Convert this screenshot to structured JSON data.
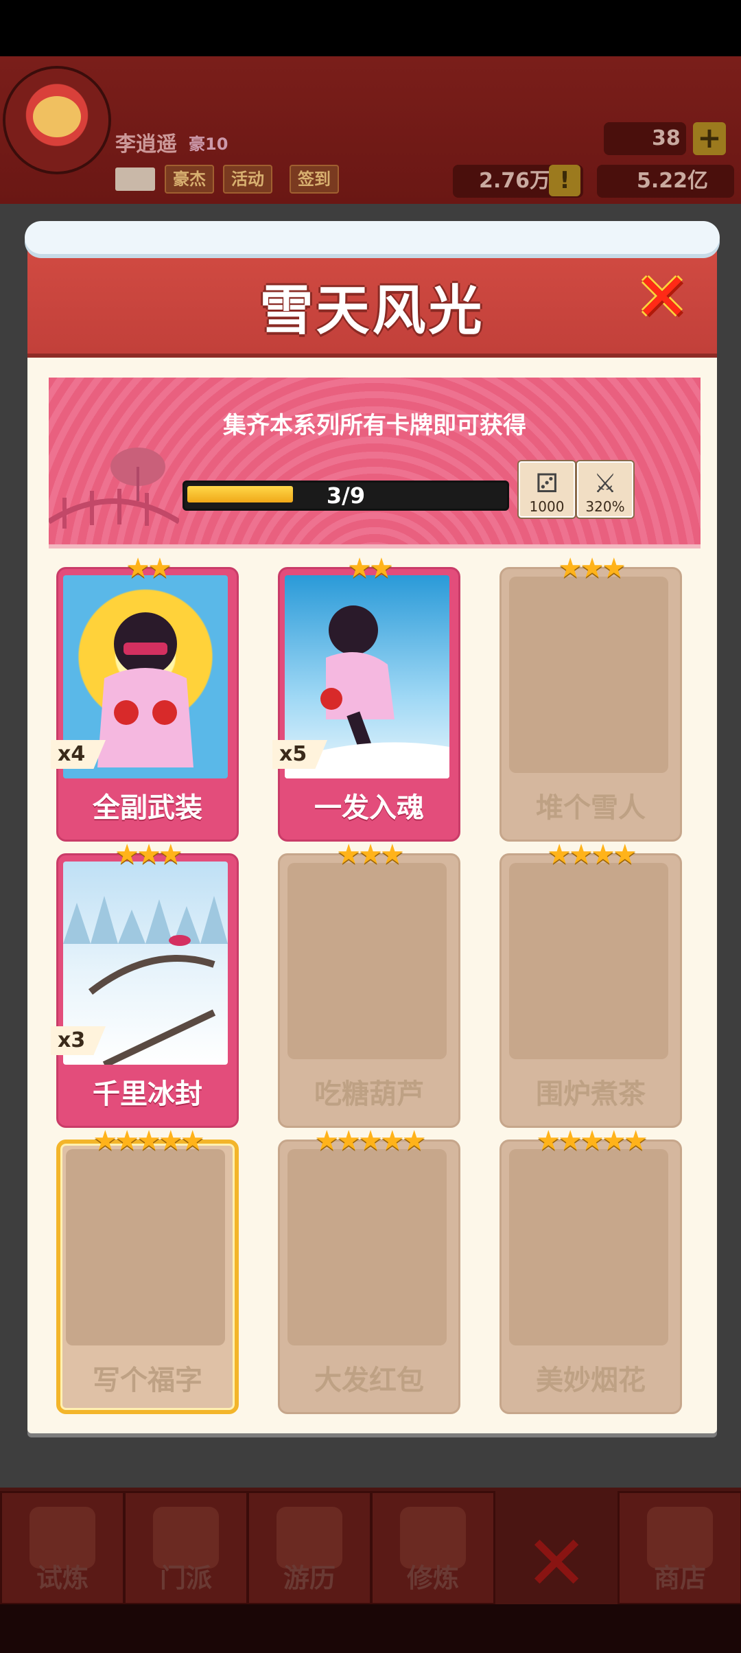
{
  "header": {
    "player_name": "李逍遥",
    "player_level": "豪10",
    "buttons": [
      "豪杰",
      "活动",
      "签到"
    ],
    "gems": "38",
    "power": "2.76万",
    "coins": "5.22亿",
    "plus": "+",
    "warn": "!"
  },
  "modal": {
    "title": "雪天风光",
    "close_glyph": "✕",
    "banner_text": "集齐本系列所有卡牌即可获得",
    "progress_text": "3/9",
    "progress_fraction": 0.333,
    "rewards": [
      {
        "icon": "dice-icon",
        "glyph": "⚂",
        "label": "1000"
      },
      {
        "icon": "sword-icon",
        "glyph": "⚔",
        "label": "320%"
      }
    ],
    "cards": [
      {
        "name": "全副武装",
        "stars": "★★",
        "count": "x4",
        "owned": true
      },
      {
        "name": "一发入魂",
        "stars": "★★",
        "count": "x5",
        "owned": true
      },
      {
        "name": "堆个雪人",
        "stars": "★★★",
        "count": "",
        "owned": false
      },
      {
        "name": "千里冰封",
        "stars": "★★★",
        "count": "x3",
        "owned": true
      },
      {
        "name": "吃糖葫芦",
        "stars": "★★★",
        "count": "",
        "owned": false
      },
      {
        "name": "围炉煮茶",
        "stars": "★★★★",
        "count": "",
        "owned": false
      },
      {
        "name": "写个福字",
        "stars": "★★★★★",
        "count": "",
        "owned": false
      },
      {
        "name": "大发红包",
        "stars": "★★★★★",
        "count": "",
        "owned": false
      },
      {
        "name": "美妙烟花",
        "stars": "★★★★★",
        "count": "",
        "owned": false
      }
    ]
  },
  "nav": {
    "tabs": [
      "试炼",
      "门派",
      "游历",
      "修炼",
      "商店"
    ],
    "close_glyph": "✕"
  },
  "colors": {
    "owned_card": "#e34d7b",
    "locked_card": "#d5b79e",
    "header_red": "#c2403a",
    "progress_gold": "#f0a818"
  }
}
